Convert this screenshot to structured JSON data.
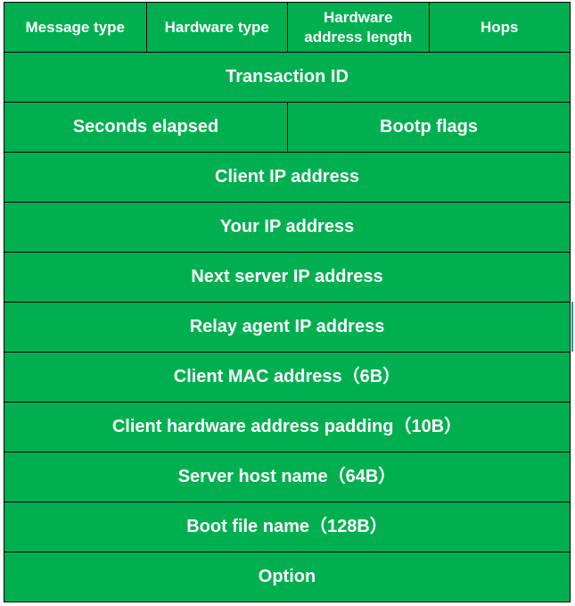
{
  "header_row": [
    {
      "label": "Message type"
    },
    {
      "label": "Hardware type"
    },
    {
      "label": "Hardware\naddress length"
    },
    {
      "label": "Hops"
    }
  ],
  "transaction_id": "Transaction ID",
  "seconds_elapsed": "Seconds elapsed",
  "bootp_flags": "Bootp flags",
  "client_ip": "Client IP address",
  "your_ip": "Your IP address",
  "next_server_ip": "Next server IP address",
  "relay_agent_ip": "Relay agent IP address",
  "client_mac": "Client MAC address（6B）",
  "client_hw_padding": "Client hardware address padding（10B）",
  "server_host_name": "Server host name（64B）",
  "boot_file_name": "Boot file name（128B）",
  "option": "Option",
  "colors": {
    "fill": "#00b050",
    "text": "#ffffff",
    "border": "#000000"
  }
}
